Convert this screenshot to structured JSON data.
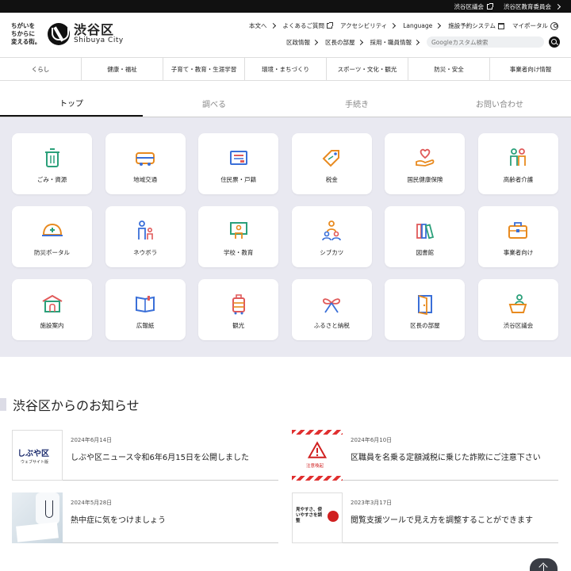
{
  "topbar": {
    "links": [
      "渋谷区議会",
      "渋谷区教育委員会"
    ]
  },
  "header": {
    "tagline": "ちがいを ちからに 変える街。",
    "brand_jp": "渋谷区",
    "brand_en": "Shibuya City",
    "nav1": [
      "本文へ",
      "よくあるご質問",
      "アクセシビリティ",
      "Language",
      "施設予約システム",
      "マイポータル"
    ],
    "nav2": [
      "区政情報",
      "区長の部屋",
      "採用・職員情報"
    ],
    "search_placeholder": "Googleカスタム検索"
  },
  "categories": [
    "くらし",
    "健康・福祉",
    "子育て・教育・生涯学習",
    "環境・まちづくり",
    "スポーツ・文化・観光",
    "防災・安全",
    "事業者向け情報"
  ],
  "tabs": [
    "トップ",
    "調べる",
    "手続き",
    "お問い合わせ"
  ],
  "grid": [
    {
      "label": "ごみ・資源",
      "icon": "trash-icon"
    },
    {
      "label": "地域交通",
      "icon": "bus-icon"
    },
    {
      "label": "住民票・戸籍",
      "icon": "document-icon"
    },
    {
      "label": "税金",
      "icon": "tag-icon"
    },
    {
      "label": "国民健康保険",
      "icon": "heart-hand-icon"
    },
    {
      "label": "高齢者介護",
      "icon": "elderly-icon"
    },
    {
      "label": "防災ポータル",
      "icon": "helmet-icon"
    },
    {
      "label": "ネウボラ",
      "icon": "parent-child-icon"
    },
    {
      "label": "学校・教育",
      "icon": "blackboard-icon"
    },
    {
      "label": "シブカツ",
      "icon": "community-icon"
    },
    {
      "label": "図書館",
      "icon": "books-icon"
    },
    {
      "label": "事業者向け",
      "icon": "briefcase-icon"
    },
    {
      "label": "施設案内",
      "icon": "building-icon"
    },
    {
      "label": "広報紙",
      "icon": "newspaper-icon"
    },
    {
      "label": "観光",
      "icon": "suitcase-icon"
    },
    {
      "label": "ふるさと納税",
      "icon": "ribbon-icon"
    },
    {
      "label": "区長の部屋",
      "icon": "door-icon"
    },
    {
      "label": "渋谷区議会",
      "icon": "podium-icon"
    }
  ],
  "news_heading": "渋谷区からのお知らせ",
  "news": [
    {
      "date": "2024年6月14日",
      "title": "しぶや区ニュース令和6年6月15日を公開しました",
      "thumb_text": "しぶや区",
      "thumb_sub": "ウェブサイト版"
    },
    {
      "date": "2024年6月10日",
      "title": "区職員を名乗る定額減税に乗じた詐欺にご注意下さい",
      "thumb_text": "注意喚起"
    },
    {
      "date": "2024年5月28日",
      "title": "熱中症に気をつけましょう"
    },
    {
      "date": "2023年3月17日",
      "title": "閲覧支援ツールで見え方を調整することができます",
      "thumb_text": "見やすさ、使いやすさを調整"
    }
  ]
}
